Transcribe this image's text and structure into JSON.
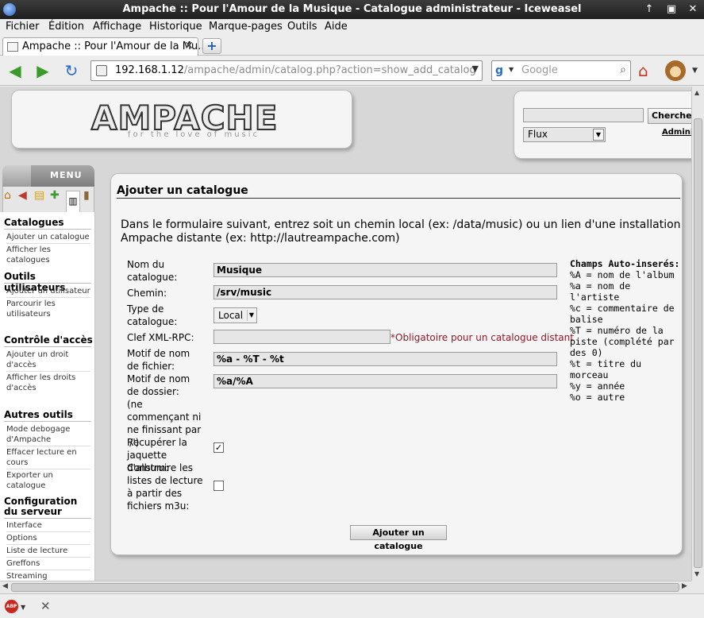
{
  "window": {
    "title": "Ampache :: Pour l'Amour de la Musique - Catalogue administrateur - Iceweasel",
    "controls": [
      "↑",
      "▣",
      "✕"
    ]
  },
  "menubar": {
    "items": [
      {
        "label": "Fichier"
      },
      {
        "label": "Édition"
      },
      {
        "label": "Affichage"
      },
      {
        "label": "Historique"
      },
      {
        "label": "Marque-pages"
      },
      {
        "label": "Outils"
      },
      {
        "label": "Aide"
      }
    ]
  },
  "tabbar": {
    "tab_label": "Ampache :: Pour l'Amour de la Mu...",
    "close_glyph": "✕",
    "newtab_glyph": "+"
  },
  "navbar": {
    "url_host": "192.168.1.12",
    "url_path": "/ampache/admin/catalog.php?action=show_add_catalog",
    "search_engine_letter": "g",
    "search_placeholder": "Google",
    "icons": {
      "back": "arrow-left-icon",
      "forward": "arrow-right-icon",
      "reload": "reload-icon",
      "home": "home-icon",
      "monkey": "greasemonkey-icon"
    }
  },
  "page": {
    "logo_text": "AMPACHE",
    "logo_tagline": "for the love of music",
    "topbox": {
      "search_value": "",
      "search_button": "Chercher",
      "flux_selected": "Flux",
      "admin_link": "Administration"
    },
    "sidebar": {
      "menu_label": "MENU",
      "sections": [
        {
          "title": "Catalogues",
          "links": [
            "Ajouter un catalogue",
            "Afficher les catalogues"
          ]
        },
        {
          "title": "Outils utilisateurs",
          "links": [
            "Ajouter un utilisateur",
            "Parcourir les utilisateurs"
          ]
        },
        {
          "title": "Contrôle d'accès",
          "links": [
            "Ajouter un droit d'accès",
            "Afficher les droits d'accès"
          ]
        },
        {
          "title": "Autres outils",
          "links": [
            "Mode debogage d'Ampache",
            "Effacer lecture en cours",
            "Exporter un catalogue"
          ]
        },
        {
          "title": "Configuration du serveur",
          "links": [
            "Interface",
            "Options",
            "Liste de lecture",
            "Greffons",
            "Streaming"
          ]
        }
      ]
    },
    "main": {
      "heading": "Ajouter un catalogue",
      "intro": "Dans le formulaire suivant, entrez soit un chemin local (ex: /data/music) ou un lien d'une installation Ampache distante (ex: http://lautreampache.com)",
      "fields": {
        "name_label": "Nom du catalogue:",
        "name_value": "Musique",
        "path_label": "Chemin:",
        "path_value": "/srv/music",
        "type_label": "Type de catalogue:",
        "type_value": "Local",
        "xmlrpc_label": "Clef XML-RPC:",
        "xmlrpc_value": "",
        "xmlrpc_note": "*Obligatoire pour un catalogue distant",
        "file_pattern_label": "Motif de nom de fichier:",
        "file_pattern_value": "%a - %T - %t",
        "folder_pattern_label": "Motif de nom de dossier:\n(ne commençant ni ne finissant par '/')",
        "folder_pattern_value": "%a/%A",
        "art_label": "Recupérer la jaquette d'album:",
        "art_checked": true,
        "art_check_glyph": "✓",
        "m3u_label": "Construire les listes de lecture à partir des fichiers m3u:",
        "m3u_checked": false
      },
      "submit_label": "Ajouter un catalogue",
      "help": {
        "title": "Champs Auto-inserés:",
        "lines": [
          "%A = nom de l'album",
          "%a = nom de l'artiste",
          "%c = commentaire de balise",
          "%T = numéro de la piste (complété par des 0)",
          "%t = titre du morceau",
          "%y = année",
          "%o = autre"
        ]
      }
    }
  },
  "statusbar": {
    "abp_label": "ABP"
  }
}
